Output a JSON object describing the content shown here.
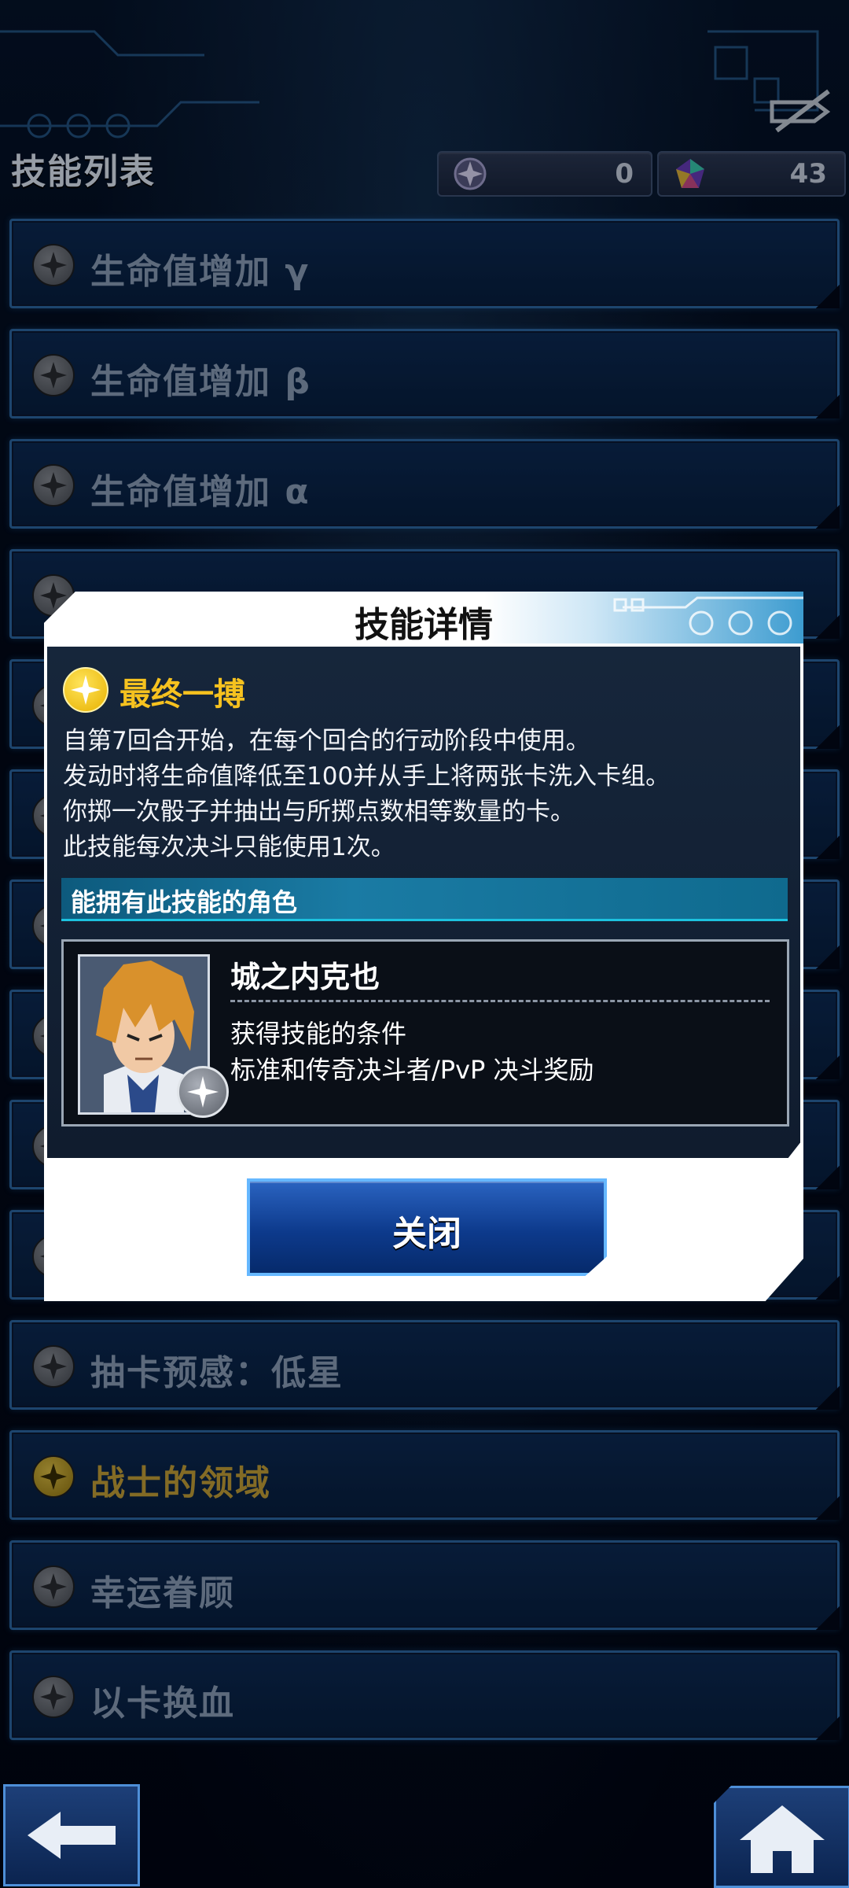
{
  "header": {
    "title": "技能列表",
    "currencies": [
      {
        "icon": "purple-orb-icon",
        "value": "0"
      },
      {
        "icon": "rainbow-gem-icon",
        "value": "43"
      }
    ]
  },
  "skills": [
    {
      "label": "生命值增加 γ",
      "highlight": false
    },
    {
      "label": "生命值增加 β",
      "highlight": false
    },
    {
      "label": "生命值增加 α",
      "highlight": false
    },
    {
      "label": "",
      "highlight": false
    },
    {
      "label": "",
      "highlight": false
    },
    {
      "label": "",
      "highlight": false
    },
    {
      "label": "",
      "highlight": false
    },
    {
      "label": "",
      "highlight": false
    },
    {
      "label": "",
      "highlight": false
    },
    {
      "label": "",
      "highlight": false
    },
    {
      "label": "抽卡预感：低星",
      "highlight": false
    },
    {
      "label": "战士的领域",
      "highlight": true
    },
    {
      "label": "幸运眷顾",
      "highlight": false
    },
    {
      "label": "以卡换血",
      "highlight": false
    }
  ],
  "dialog": {
    "title": "技能详情",
    "skill_name": "最终一搏",
    "description": [
      "自第7回合开始，在每个回合的行动阶段中使用。",
      "发动时将生命值降低至100并从手上将两张卡洗入卡组。",
      "你掷一次骰子并抽出与所掷点数相等数量的卡。",
      "此技能每次决斗只能使用1次。"
    ],
    "section_title": "能拥有此技能的角色",
    "character": {
      "name": "城之内克也",
      "condition_title": "获得技能的条件",
      "condition_text": "标准和传奇决斗者/PvP 决斗奖励"
    },
    "close_label": "关闭"
  },
  "colors": {
    "accent_gold": "#f6c21f",
    "row_border": "#2d6aa9",
    "section_bar": "#1a7ba4"
  }
}
